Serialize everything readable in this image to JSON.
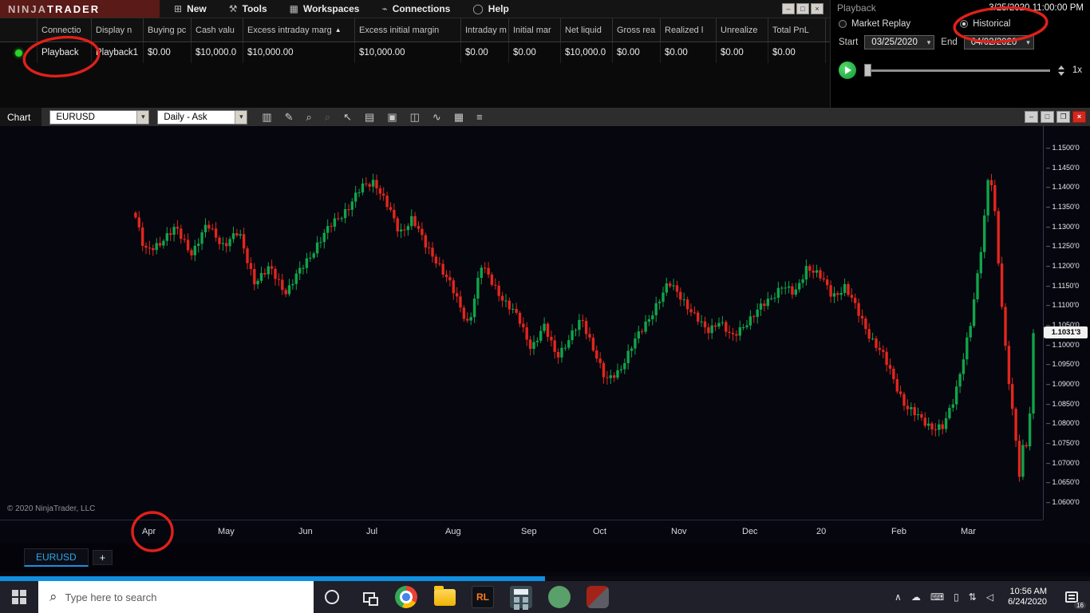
{
  "titlebar": {
    "logo_ninja": "NINJA",
    "logo_trader": "TRADER",
    "menus": [
      {
        "label": "New",
        "icon": "⊞"
      },
      {
        "label": "Tools",
        "icon": "⚒"
      },
      {
        "label": "Workspaces",
        "icon": "▦"
      },
      {
        "label": "Connections",
        "icon": "⌁"
      },
      {
        "label": "Help",
        "icon": "◯"
      }
    ],
    "window_buttons": [
      "–",
      "□",
      "×"
    ]
  },
  "playback": {
    "title": "Playback",
    "datetime": "3/25/2020 11:00:00 PM",
    "mode_options": [
      {
        "label": "Market Replay",
        "selected": false
      },
      {
        "label": "Historical",
        "selected": true
      }
    ],
    "start_label": "Start",
    "start_value": "03/25/2020",
    "end_label": "End",
    "end_value": "04/02/2020",
    "speed": "1x"
  },
  "accounts_table": {
    "columns": [
      "Connectio",
      "Display n",
      "Buying pc",
      "Cash valu",
      "Excess intraday marg",
      "Excess initial margin",
      "Intraday m",
      "Initial mar",
      "Net liquid",
      "Gross rea",
      "Realized l",
      "Unrealize",
      "Total PnL"
    ],
    "sort_column_index": 4,
    "sort_indicator": "▲",
    "row": {
      "status": "connected",
      "cells": [
        "Playback",
        "Playback1",
        "$0.00",
        "$10,000.0",
        "$10,000.00",
        "$10,000.00",
        "$0.00",
        "$0.00",
        "$10,000.0",
        "$0.00",
        "$0.00",
        "$0.00",
        "$0.00"
      ]
    }
  },
  "chart_window": {
    "title": "Chart",
    "instrument_value": "EURUSD",
    "period_value": "Daily - Ask",
    "toolbar_icons": [
      {
        "name": "bar-type-icon",
        "glyph": "▥"
      },
      {
        "name": "drawing-tools-icon",
        "glyph": "✎"
      },
      {
        "name": "zoom-in-icon",
        "glyph": "⌕"
      },
      {
        "name": "zoom-out-icon",
        "glyph": "⌕",
        "disabled": true
      },
      {
        "name": "cursor-icon",
        "glyph": "↖"
      },
      {
        "name": "report-icon",
        "glyph": "▤"
      },
      {
        "name": "chart-trader-icon",
        "glyph": "▣"
      },
      {
        "name": "data-series-icon",
        "glyph": "◫"
      },
      {
        "name": "indicators-icon",
        "glyph": "∿"
      },
      {
        "name": "grid-icon",
        "glyph": "▦"
      },
      {
        "name": "data-box-icon",
        "glyph": "≡"
      }
    ],
    "window_buttons": [
      "–",
      "□",
      "❒"
    ],
    "close_button": "×",
    "copyright": "© 2020 NinjaTrader, LLC",
    "tab_label": "EURUSD",
    "add_tab_label": "+"
  },
  "chart_data": {
    "type": "candlestick",
    "title": "EURUSD Daily - Ask",
    "instrument": "EURUSD",
    "interval": "Daily",
    "ylim": [
      1.0557,
      1.1557
    ],
    "up_color": "#10a44a",
    "down_color": "#e2261d",
    "candle_count": 258,
    "data_start_frac": 0.13,
    "last_price": 1.10313,
    "last_price_label": "1.1031'3",
    "y_ticks": [
      {
        "v": 1.15,
        "label": "1.1500'0"
      },
      {
        "v": 1.145,
        "label": "1.1450'0"
      },
      {
        "v": 1.14,
        "label": "1.1400'0"
      },
      {
        "v": 1.135,
        "label": "1.1350'0"
      },
      {
        "v": 1.13,
        "label": "1.1300'0"
      },
      {
        "v": 1.125,
        "label": "1.1250'0"
      },
      {
        "v": 1.12,
        "label": "1.1200'0"
      },
      {
        "v": 1.115,
        "label": "1.1150'0"
      },
      {
        "v": 1.11,
        "label": "1.1100'0"
      },
      {
        "v": 1.105,
        "label": "1.1050'0"
      },
      {
        "v": 1.1,
        "label": "1.1000'0"
      },
      {
        "v": 1.095,
        "label": "1.0950'0"
      },
      {
        "v": 1.09,
        "label": "1.0900'0"
      },
      {
        "v": 1.085,
        "label": "1.0850'0"
      },
      {
        "v": 1.08,
        "label": "1.0800'0"
      },
      {
        "v": 1.075,
        "label": "1.0750'0"
      },
      {
        "v": 1.07,
        "label": "1.0700'0"
      },
      {
        "v": 1.065,
        "label": "1.0650'0"
      },
      {
        "v": 1.06,
        "label": "1.0600'0"
      }
    ],
    "x_labels": [
      {
        "f": 0.145,
        "label": "Apr"
      },
      {
        "f": 0.218,
        "label": "May"
      },
      {
        "f": 0.295,
        "label": "Jun"
      },
      {
        "f": 0.36,
        "label": "Jul"
      },
      {
        "f": 0.436,
        "label": "Aug"
      },
      {
        "f": 0.509,
        "label": "Sep"
      },
      {
        "f": 0.578,
        "label": "Oct"
      },
      {
        "f": 0.653,
        "label": "Nov"
      },
      {
        "f": 0.721,
        "label": "Dec"
      },
      {
        "f": 0.792,
        "label": "20"
      },
      {
        "f": 0.864,
        "label": "Feb"
      },
      {
        "f": 0.93,
        "label": "Mar"
      }
    ],
    "close_anchors": [
      [
        0.0,
        1.1325
      ],
      [
        0.01,
        1.1235
      ],
      [
        0.028,
        1.1265
      ],
      [
        0.045,
        1.1295
      ],
      [
        0.063,
        1.1235
      ],
      [
        0.08,
        1.1305
      ],
      [
        0.098,
        1.1255
      ],
      [
        0.115,
        1.1285
      ],
      [
        0.133,
        1.116
      ],
      [
        0.15,
        1.1195
      ],
      [
        0.168,
        1.1135
      ],
      [
        0.185,
        1.1195
      ],
      [
        0.203,
        1.126
      ],
      [
        0.22,
        1.131
      ],
      [
        0.238,
        1.1355
      ],
      [
        0.252,
        1.14
      ],
      [
        0.266,
        1.142
      ],
      [
        0.28,
        1.1355
      ],
      [
        0.294,
        1.1285
      ],
      [
        0.308,
        1.1325
      ],
      [
        0.322,
        1.1255
      ],
      [
        0.336,
        1.1215
      ],
      [
        0.35,
        1.1155
      ],
      [
        0.364,
        1.1085
      ],
      [
        0.371,
        1.1055
      ],
      [
        0.385,
        1.12
      ],
      [
        0.399,
        1.1155
      ],
      [
        0.413,
        1.1105
      ],
      [
        0.427,
        1.1065
      ],
      [
        0.441,
        1.0995
      ],
      [
        0.455,
        1.1045
      ],
      [
        0.469,
        1.0975
      ],
      [
        0.483,
        1.1015
      ],
      [
        0.497,
        1.1065
      ],
      [
        0.51,
        1.0995
      ],
      [
        0.524,
        1.0905
      ],
      [
        0.538,
        1.0935
      ],
      [
        0.552,
        1.0995
      ],
      [
        0.566,
        1.1045
      ],
      [
        0.58,
        1.1105
      ],
      [
        0.594,
        1.1155
      ],
      [
        0.608,
        1.1125
      ],
      [
        0.622,
        1.1075
      ],
      [
        0.636,
        1.1035
      ],
      [
        0.65,
        1.1065
      ],
      [
        0.664,
        1.1015
      ],
      [
        0.678,
        1.1055
      ],
      [
        0.692,
        1.1085
      ],
      [
        0.706,
        1.1115
      ],
      [
        0.72,
        1.1155
      ],
      [
        0.734,
        1.1125
      ],
      [
        0.748,
        1.1205
      ],
      [
        0.762,
        1.1175
      ],
      [
        0.776,
        1.1125
      ],
      [
        0.79,
        1.115
      ],
      [
        0.804,
        1.1085
      ],
      [
        0.818,
        1.1025
      ],
      [
        0.832,
        1.0975
      ],
      [
        0.846,
        1.0905
      ],
      [
        0.858,
        1.0845
      ],
      [
        0.872,
        1.0815
      ],
      [
        0.886,
        1.0795
      ],
      [
        0.9,
        1.079
      ],
      [
        0.912,
        1.0865
      ],
      [
        0.924,
        1.0995
      ],
      [
        0.93,
        1.1055
      ],
      [
        0.94,
        1.1205
      ],
      [
        0.947,
        1.1355
      ],
      [
        0.951,
        1.1465
      ],
      [
        0.957,
        1.1345
      ],
      [
        0.963,
        1.1155
      ],
      [
        0.97,
        1.0955
      ],
      [
        0.978,
        1.0805
      ],
      [
        0.985,
        1.0665
      ],
      [
        0.99,
        1.0785
      ],
      [
        0.994,
        1.0725
      ],
      [
        1.0,
        1.1031
      ]
    ]
  },
  "taskbar": {
    "search_placeholder": "Type here to search",
    "apps": [
      {
        "name": "chrome"
      },
      {
        "name": "file-explorer"
      },
      {
        "name": "rl-app",
        "label": "RL"
      },
      {
        "name": "calculator"
      },
      {
        "name": "green-app"
      },
      {
        "name": "ninjatrader"
      }
    ],
    "tray_icons": [
      {
        "name": "chevron-up-icon",
        "glyph": "∧"
      },
      {
        "name": "cloud-icon",
        "glyph": "☁"
      },
      {
        "name": "keyboard-icon",
        "glyph": "⌨"
      },
      {
        "name": "battery-icon",
        "glyph": "▯"
      },
      {
        "name": "network-icon",
        "glyph": "⇅"
      },
      {
        "name": "volume-icon",
        "glyph": "◁"
      }
    ],
    "clock_time": "10:56 AM",
    "clock_date": "6/24/2020",
    "notification_count": "16"
  }
}
